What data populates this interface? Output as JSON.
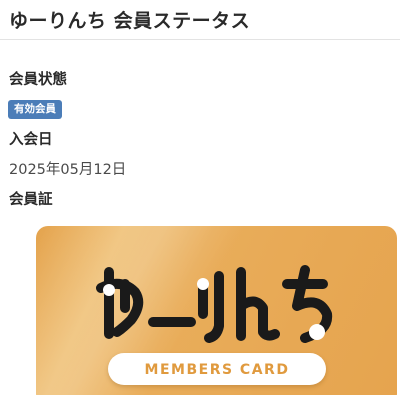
{
  "header": {
    "title": "ゆーりんち 会員ステータス"
  },
  "membership": {
    "status_label": "会員状態",
    "status_badge": "有効会員",
    "join_label": "入会日",
    "join_date": "2025年05月12日",
    "card_label": "会員証"
  },
  "card": {
    "logo_text": "ゆーりんち",
    "pill_text": "MEMBERS CARD",
    "colors": {
      "card": "#e9ad5a",
      "pill_text": "#e09a3e",
      "logo": "#1a1a1a"
    }
  },
  "colors": {
    "badge": "#4b7db8"
  }
}
